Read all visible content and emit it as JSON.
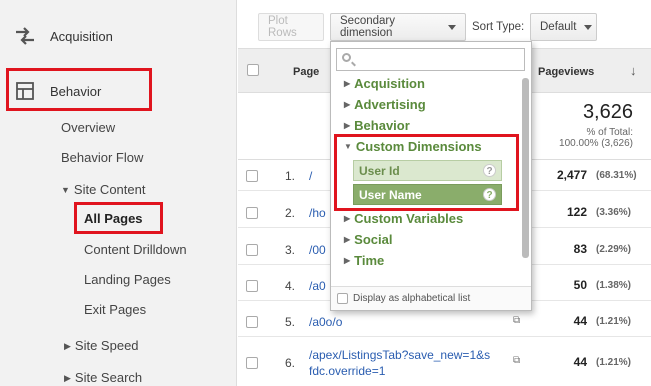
{
  "sidebar": {
    "acquisition": "Acquisition",
    "behavior": "Behavior",
    "overview": "Overview",
    "behavior_flow": "Behavior Flow",
    "site_content": "Site Content",
    "all_pages": "All Pages",
    "content_drilldown": "Content Drilldown",
    "landing_pages": "Landing Pages",
    "exit_pages": "Exit Pages",
    "site_speed": "Site Speed",
    "site_search": "Site Search"
  },
  "toolbar": {
    "plot_rows": "Plot Rows",
    "secondary_dimension": "Secondary dimension",
    "sort_type_label": "Sort Type:",
    "sort_type_value": "Default"
  },
  "table": {
    "col_page": "Page",
    "col_pageviews": "Pageviews",
    "summary": {
      "value": "3,626",
      "sub1": "% of Total:",
      "sub2": "100.00% (3,626)"
    },
    "rows": [
      {
        "num": "1.",
        "path": "/",
        "pageviews": "2,477",
        "pct": "(68.31%)"
      },
      {
        "num": "2.",
        "path": "/ho",
        "pageviews": "122",
        "pct": "(3.36%)"
      },
      {
        "num": "3.",
        "path": "/00",
        "pageviews": "83",
        "pct": "(2.29%)"
      },
      {
        "num": "4.",
        "path": "/a0",
        "pageviews": "50",
        "pct": "(1.38%)"
      },
      {
        "num": "5.",
        "path": "/a0o/o",
        "pageviews": "44",
        "pct": "(1.21%)"
      },
      {
        "num": "6.",
        "path": "/apex/ListingsTab?save_new=1&s",
        "path2": "fdc.override=1",
        "pageviews": "44",
        "pct": "(1.21%)"
      }
    ]
  },
  "dropdown": {
    "search_placeholder": "",
    "items": [
      "Acquisition",
      "Advertising",
      "Behavior",
      "Custom Dimensions",
      "Custom Variables",
      "Social",
      "Time"
    ],
    "custom_dims": [
      "User Id",
      "User Name"
    ],
    "help": "?",
    "footer": "Display as alphabetical list"
  },
  "colors": {
    "highlight_red": "#e0141e",
    "dimension_green": "#5a8a3c",
    "selected_green": "#8aad6b",
    "link_blue": "#2a5db0"
  }
}
